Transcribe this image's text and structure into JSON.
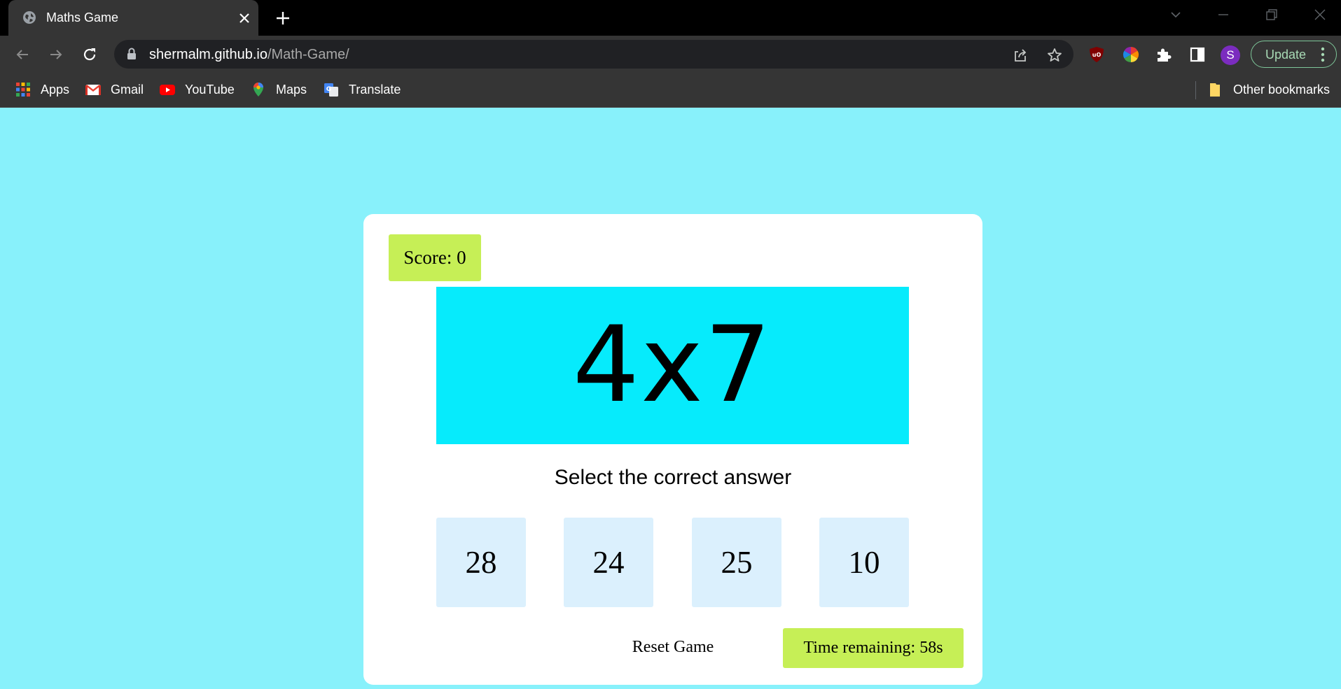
{
  "browser": {
    "tab_title": "Maths Game",
    "url_host": "shermalm.github.io",
    "url_path": "/Math-Game/",
    "update_label": "Update",
    "avatar_letter": "S",
    "bookmarks": [
      {
        "label": "Apps",
        "icon": "apps-grid-icon"
      },
      {
        "label": "Gmail",
        "icon": "gmail-icon"
      },
      {
        "label": "YouTube",
        "icon": "youtube-icon"
      },
      {
        "label": "Maps",
        "icon": "maps-pin-icon"
      },
      {
        "label": "Translate",
        "icon": "translate-icon"
      }
    ],
    "other_bookmarks": "Other bookmarks"
  },
  "game": {
    "score_label": "Score: 0",
    "question": "4x7",
    "instruction": "Select the correct answer",
    "choices": [
      "28",
      "24",
      "25",
      "10"
    ],
    "reset_label": "Reset Game",
    "timer_label": "Time remaining: 58s"
  },
  "colors": {
    "page_background": "#88f1fb",
    "question_background": "#06ebfc",
    "badge_background": "#c6ef56",
    "choice_background": "#dbf0fd"
  }
}
